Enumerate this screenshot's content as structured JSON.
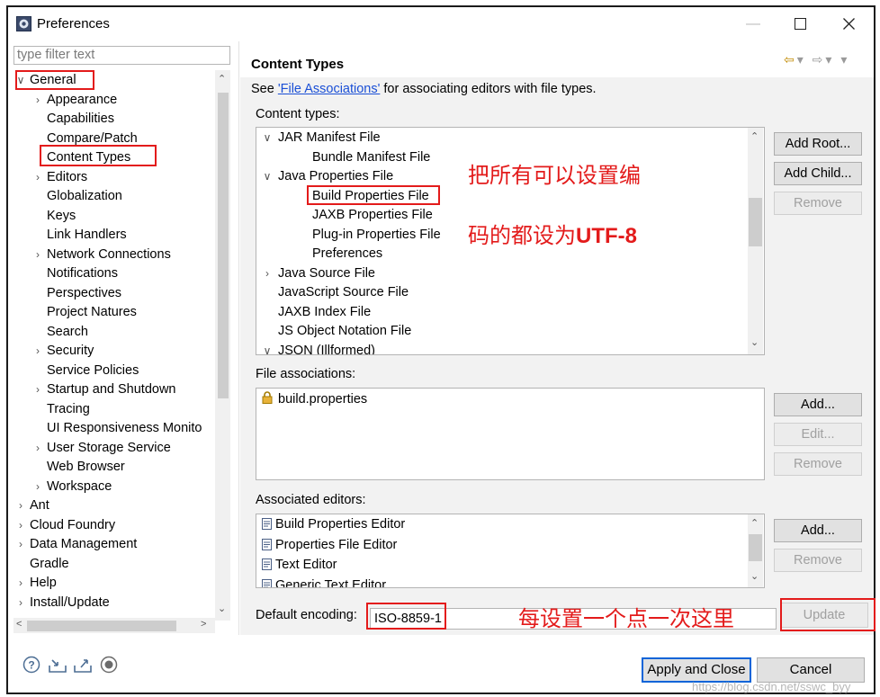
{
  "window": {
    "title": "Preferences",
    "controls": [
      "—",
      "☐",
      "✕"
    ]
  },
  "left": {
    "filter_placeholder": "type filter text",
    "tree": [
      {
        "label": "General",
        "depth": 0,
        "expander": "expanded"
      },
      {
        "label": "Appearance",
        "depth": 1,
        "expander": "collapsed"
      },
      {
        "label": "Capabilities",
        "depth": 1,
        "expander": "none"
      },
      {
        "label": "Compare/Patch",
        "depth": 1,
        "expander": "none"
      },
      {
        "label": "Content Types",
        "depth": 1,
        "expander": "none"
      },
      {
        "label": "Editors",
        "depth": 1,
        "expander": "collapsed"
      },
      {
        "label": "Globalization",
        "depth": 1,
        "expander": "none"
      },
      {
        "label": "Keys",
        "depth": 1,
        "expander": "none"
      },
      {
        "label": "Link Handlers",
        "depth": 1,
        "expander": "none"
      },
      {
        "label": "Network Connections",
        "depth": 1,
        "expander": "collapsed"
      },
      {
        "label": "Notifications",
        "depth": 1,
        "expander": "none"
      },
      {
        "label": "Perspectives",
        "depth": 1,
        "expander": "none"
      },
      {
        "label": "Project Natures",
        "depth": 1,
        "expander": "none"
      },
      {
        "label": "Search",
        "depth": 1,
        "expander": "none"
      },
      {
        "label": "Security",
        "depth": 1,
        "expander": "collapsed"
      },
      {
        "label": "Service Policies",
        "depth": 1,
        "expander": "none"
      },
      {
        "label": "Startup and Shutdown",
        "depth": 1,
        "expander": "collapsed"
      },
      {
        "label": "Tracing",
        "depth": 1,
        "expander": "none"
      },
      {
        "label": "UI Responsiveness Monito",
        "depth": 1,
        "expander": "none"
      },
      {
        "label": "User Storage Service",
        "depth": 1,
        "expander": "collapsed"
      },
      {
        "label": "Web Browser",
        "depth": 1,
        "expander": "none"
      },
      {
        "label": "Workspace",
        "depth": 1,
        "expander": "collapsed"
      },
      {
        "label": "Ant",
        "depth": 0,
        "expander": "collapsed"
      },
      {
        "label": "Cloud Foundry",
        "depth": 0,
        "expander": "collapsed"
      },
      {
        "label": "Data Management",
        "depth": 0,
        "expander": "collapsed"
      },
      {
        "label": "Gradle",
        "depth": 0,
        "expander": "none"
      },
      {
        "label": "Help",
        "depth": 0,
        "expander": "collapsed"
      },
      {
        "label": "Install/Update",
        "depth": 0,
        "expander": "collapsed"
      }
    ]
  },
  "right": {
    "title": "Content Types",
    "desc_prefix": "See ",
    "desc_link": "'File Associations'",
    "desc_suffix": " for associating editors with file types.",
    "content_types_label": "Content types:",
    "content_types": [
      {
        "label": "JAR Manifest File",
        "depth": 0,
        "expander": "expanded"
      },
      {
        "label": "Bundle Manifest File",
        "depth": 1,
        "expander": "none"
      },
      {
        "label": "Java Properties File",
        "depth": 0,
        "expander": "expanded"
      },
      {
        "label": "Build Properties File",
        "depth": 1,
        "expander": "none"
      },
      {
        "label": "JAXB Properties File",
        "depth": 1,
        "expander": "none"
      },
      {
        "label": "Plug-in Properties File",
        "depth": 1,
        "expander": "none"
      },
      {
        "label": "Preferences",
        "depth": 1,
        "expander": "none"
      },
      {
        "label": "Java Source File",
        "depth": 0,
        "expander": "collapsed"
      },
      {
        "label": "JavaScript Source File",
        "depth": 0,
        "expander": "none"
      },
      {
        "label": "JAXB Index File",
        "depth": 0,
        "expander": "none"
      },
      {
        "label": "JS Object Notation File",
        "depth": 0,
        "expander": "none"
      },
      {
        "label": "JSON (Illformed)",
        "depth": 0,
        "expander": "expanded"
      }
    ],
    "ct_buttons": {
      "add_root": "Add Root...",
      "add_child": "Add Child...",
      "remove": "Remove"
    },
    "file_assoc_label": "File associations:",
    "file_assoc": [
      "build.properties"
    ],
    "fa_buttons": {
      "add": "Add...",
      "edit": "Edit...",
      "remove": "Remove"
    },
    "assoc_editors_label": "Associated editors:",
    "assoc_editors": [
      "Build Properties Editor",
      "Properties File Editor",
      "Text Editor",
      "Generic Text Editor"
    ],
    "ae_buttons": {
      "add": "Add...",
      "remove": "Remove"
    },
    "encoding_label": "Default encoding:",
    "encoding_value": "ISO-8859-1",
    "update_button": "Update"
  },
  "annotations": {
    "line1": "把所有可以设置编",
    "line2_prefix": "码的都设为",
    "line2_bold": "UTF-8",
    "line3": "每设置一个点一次这里"
  },
  "footer": {
    "apply_close": "Apply and Close",
    "cancel": "Cancel",
    "watermark": "https://blog.csdn.net/sswc_byy"
  },
  "colors": {
    "annotation_red": "#e31b1b",
    "link_blue": "#1a4fd6",
    "primary_border": "#0a64d8"
  }
}
